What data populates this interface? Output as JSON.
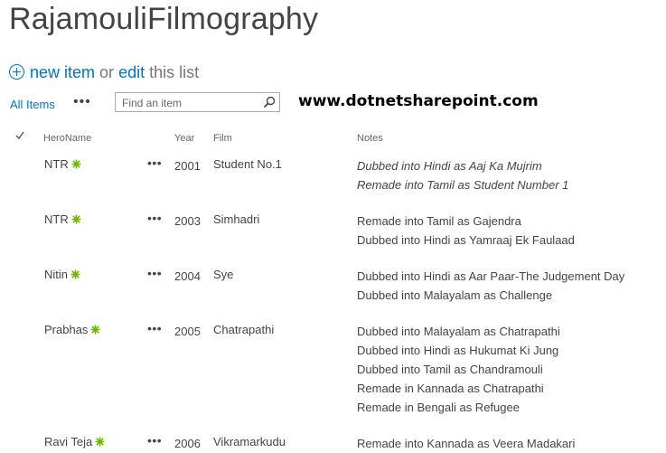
{
  "title": "RajamouliFilmography",
  "actions": {
    "new_item": "new item",
    "or": "or",
    "edit": "edit",
    "this_list": "this list"
  },
  "view": {
    "all_items": "All Items",
    "more": "•••"
  },
  "search": {
    "placeholder": "Find an item"
  },
  "watermark": "www.dotnetsharepoint.com",
  "columns": {
    "hero": "HeroName",
    "year": "Year",
    "film": "Film",
    "notes": "Notes"
  },
  "rows": [
    {
      "hero": "NTR",
      "more": "•••",
      "year": "2001",
      "film": "Student No.1",
      "notes": [
        "Dubbed into Hindi as Aaj Ka Mujrim",
        "Remade into Tamil as Student Number 1"
      ],
      "notes_italic": true
    },
    {
      "hero": "NTR",
      "more": "•••",
      "year": "2003",
      "film": "Simhadri",
      "notes": [
        "Remade into Tamil as Gajendra",
        "Dubbed into Hindi as Yamraaj Ek Faulaad"
      ],
      "notes_italic": false
    },
    {
      "hero": "Nitin",
      "more": "•••",
      "year": "2004",
      "film": "Sye",
      "notes": [
        "Dubbed into Hindi as Aar Paar-The Judgement Day",
        "Dubbed into Malayalam as Challenge"
      ],
      "notes_italic": false
    },
    {
      "hero": "Prabhas",
      "more": "•••",
      "year": "2005",
      "film": "Chatrapathi",
      "notes": [
        "Dubbed into Malayalam as Chatrapathi",
        "Dubbed into Hindi as Hukumat Ki Jung",
        "Dubbed into Tamil as Chandramouli",
        "Remade in Kannada as Chatrapathi",
        "Remade in Bengali as Refugee"
      ],
      "notes_italic": false
    },
    {
      "hero": "Ravi Teja",
      "more": "•••",
      "year": "2006",
      "film": "Vikramarkudu",
      "notes": [
        "Remade into Kannada as Veera Madakari"
      ],
      "notes_italic": false
    }
  ],
  "colors": {
    "link": "#0072c6",
    "text": "#444444",
    "new_badge": "#6bb700"
  },
  "icons": {
    "add": "plus-circle-icon",
    "search": "magnifier-icon",
    "new": "new-item-sparkle-icon",
    "check": "checkmark-icon"
  }
}
